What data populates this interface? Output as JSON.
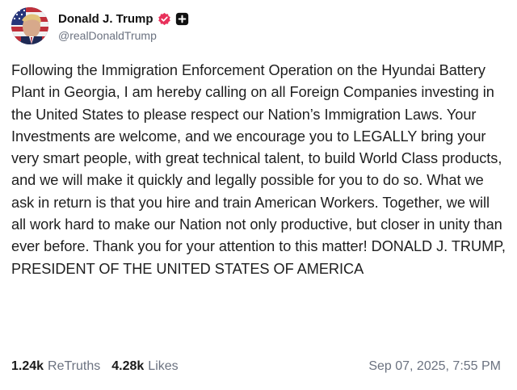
{
  "author": {
    "display_name": "Donald J. Trump",
    "handle": "@realDonaldTrump"
  },
  "post": {
    "text": "Following the Immigration Enforcement Operation on the Hyundai Battery Plant in Georgia, I am hereby calling on all Foreign Companies investing in the United States to please respect our Nation’s Immigration Laws. Your Investments are welcome, and we encourage you to LEGALLY bring your very smart people, with great technical talent, to build World Class products, and we will make it quickly and legally possible for you to do so. What we ask in return is that you hire and train American Workers. Together, we will all work hard to make our Nation not only productive, but closer in unity than ever before. Thank you for your attention to this matter! DONALD J. TRUMP, PRESIDENT OF THE UNITED STATES OF AMERICA"
  },
  "stats": {
    "retruths_count": "1.24k",
    "retruths_label": "ReTruths",
    "likes_count": "4.28k",
    "likes_label": "Likes"
  },
  "timestamp": "Sep 07, 2025, 7:55 PM",
  "icons": {
    "verified": "verified-badge-icon",
    "plus": "plus-icon"
  },
  "colors": {
    "verified_badge": "#e8315b",
    "secondary_text": "#6b7280",
    "plus_badge": "#111111"
  }
}
